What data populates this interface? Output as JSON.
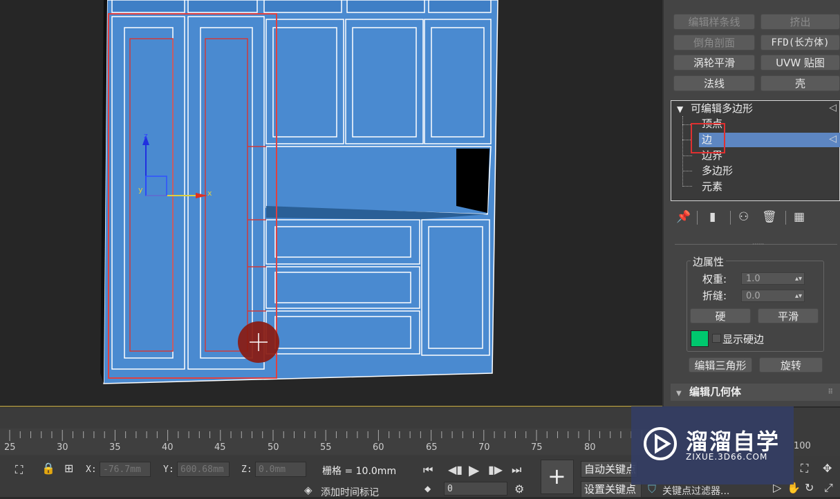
{
  "modifiers": {
    "buttons": [
      {
        "label": "编辑样条线",
        "enabled": false
      },
      {
        "label": "挤出",
        "enabled": false
      },
      {
        "label": "倒角剖面",
        "enabled": false
      },
      {
        "label": "FFD(长方体)",
        "enabled": true
      },
      {
        "label": "涡轮平滑",
        "enabled": true
      },
      {
        "label": "UVW 贴图",
        "enabled": true
      },
      {
        "label": "法线",
        "enabled": true
      },
      {
        "label": "壳",
        "enabled": true
      }
    ]
  },
  "stack": {
    "root": "可编辑多边形",
    "items": [
      "顶点",
      "边",
      "边界",
      "多边形",
      "元素"
    ],
    "selected": "边"
  },
  "edge_props": {
    "group_title": "边属性",
    "weight_label": "权重:",
    "weight_value": "1.0",
    "crease_label": "折缝:",
    "crease_value": "0.0",
    "hard_label": "硬",
    "smooth_label": "平滑",
    "show_hard_label": "显示硬边",
    "hard_color": "#00c86e",
    "edit_tri_label": "编辑三角形",
    "turn_label": "旋转"
  },
  "rollout": {
    "edit_geometry": "编辑几何体"
  },
  "viewport": {
    "gizmo_x": "x",
    "gizmo_y": "y",
    "gizmo_z": "z",
    "object_color": "#4a8ad0",
    "selection_color": "#d03a3a"
  },
  "ruler": {
    "labels": [
      "25",
      "30",
      "35",
      "40",
      "45",
      "50",
      "55",
      "60",
      "65",
      "70",
      "75",
      "80",
      "100"
    ]
  },
  "status": {
    "x_label": "X:",
    "x_value": "-76.7mm",
    "y_label": "Y:",
    "y_value": "600.68mm",
    "z_label": "Z:",
    "z_value": "0.0mm",
    "grid_text": "栅格 = 10.0mm",
    "add_time_tag": "添加时间标记",
    "auto_key": "自动关键点",
    "set_key": "设置关键点",
    "key_filter": "关键点过滤器...",
    "frame_value": "0"
  },
  "watermark": {
    "title": "溜溜自学",
    "subtitle": "ZIXUE.3D66.COM"
  }
}
